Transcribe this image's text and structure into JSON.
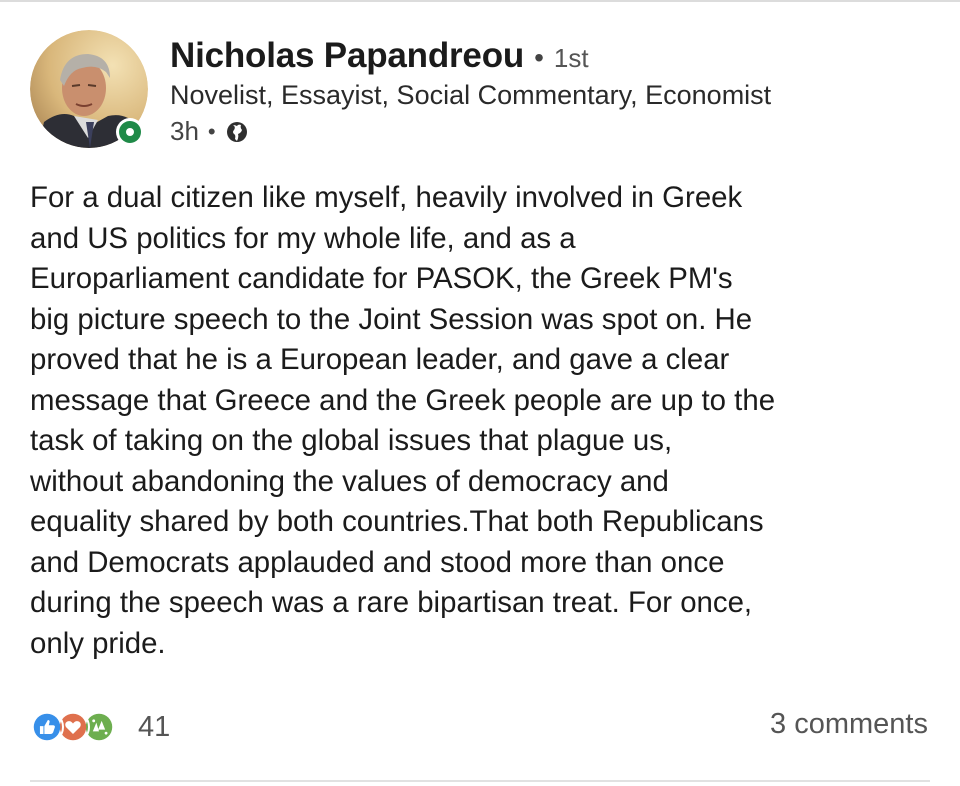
{
  "post": {
    "author": {
      "name": "Nicholas Papandreou",
      "connection_degree": "1st",
      "headline": "Novelist, Essayist, Social Commentary, Economist",
      "posted_ago": "3h",
      "visibility_icon": "globe-icon",
      "status_icon": "online-status-icon"
    },
    "body_lines": [
      "For a dual citizen like myself, heavily involved in Greek",
      "and US politics for my whole life, and as a",
      "Europarliament candidate for PASOK, the Greek PM's",
      "big picture speech to the Joint Session was spot on. He",
      "proved that he is a European leader, and gave a clear",
      "message that Greece and the Greek people are up to the",
      "task of taking on the global issues that plague us,",
      "without abandoning the values of democracy and",
      "equality shared by both countries.That both Republicans",
      "and Democrats applauded and stood more than once",
      "during the speech was a rare bipartisan treat. For once,",
      "only pride."
    ],
    "social": {
      "reaction_icons": [
        "like-icon",
        "love-icon",
        "celebrate-icon"
      ],
      "reaction_count": "41",
      "comments": "3 comments"
    }
  },
  "colors": {
    "text": "#1b1b1b",
    "secondary_text": "#555555",
    "online_green": "#1f8a48",
    "like_blue": "#378fe9",
    "love_red": "#df704d",
    "celebrate_green": "#6dae4f"
  }
}
